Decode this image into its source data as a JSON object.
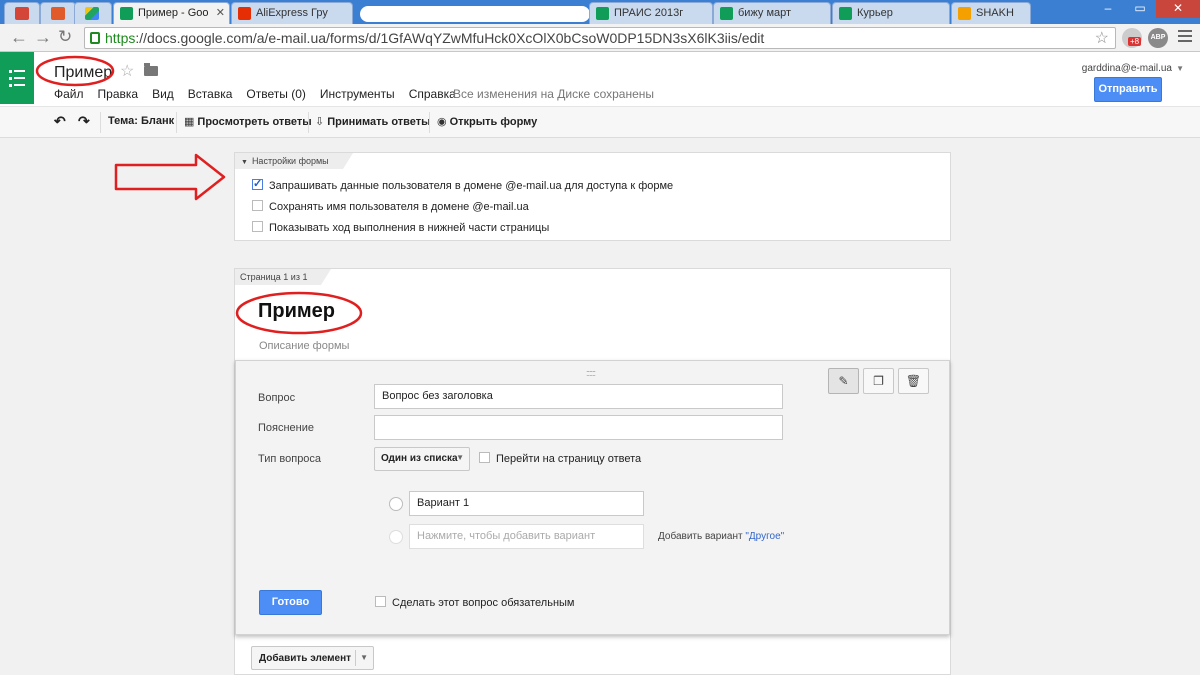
{
  "browser": {
    "tabs": [
      {
        "label": "",
        "icon": "gmail-icon"
      },
      {
        "label": "",
        "icon": "red-app-icon"
      },
      {
        "label": "",
        "icon": "drive-icon"
      },
      {
        "label": "Пример - Goo",
        "icon": "forms-icon",
        "active": true
      },
      {
        "label": "AliExpress Гру",
        "icon": "aliexpress-icon"
      },
      {
        "label": "ПРАИС 2013г",
        "icon": "sheets-icon"
      },
      {
        "label": "бижу март",
        "icon": "sheets-icon"
      },
      {
        "label": "Курьер",
        "icon": "sheets-icon"
      },
      {
        "label": "SHAKH",
        "icon": "shakh-icon"
      }
    ],
    "url_scheme": "https",
    "url_rest": "://docs.google.com/a/e-mail.ua/forms/d/1GfAWqYZwMfuHck0XcOlX0bCsoW0DP15DN3sX6lK3iis/edit",
    "ext_badge": "+8",
    "abp_label": "ABP"
  },
  "app": {
    "doc_title": "Пример",
    "menus": [
      "Файл",
      "Правка",
      "Вид",
      "Вставка",
      "Ответы (0)",
      "Инструменты",
      "Справка"
    ],
    "saved_status": "Все изменения на Диске сохранены",
    "user_email": "garddina@e-mail.ua",
    "send_label": "Отправить",
    "accent_color": "#4d8ef6",
    "brand_color": "#0f9d58"
  },
  "toolbar": {
    "theme_label": "Тема: Бланк",
    "view_responses_label": "Просмотреть ответы",
    "accept_responses_label": "Принимать ответы",
    "open_form_label": "Открыть форму"
  },
  "settings": {
    "header": "Настройки формы",
    "options": [
      {
        "label": "Запрашивать данные пользователя в домене @e-mail.ua для доступа к форме",
        "checked": true
      },
      {
        "label": "Сохранять имя пользователя в домене @e-mail.ua",
        "checked": false
      },
      {
        "label": "Показывать ход выполнения в нижней части страницы",
        "checked": false
      }
    ]
  },
  "form": {
    "page_label": "Страница 1 из 1",
    "title": "Пример",
    "description_placeholder": "Описание формы"
  },
  "question": {
    "question_label": "Вопрос",
    "question_value": "Вопрос без заголовка",
    "help_label": "Пояснение",
    "help_value": "",
    "type_label": "Тип вопроса",
    "type_value": "Один из списка",
    "go_to_page_label": "Перейти на страницу ответа",
    "option1": "Вариант 1",
    "add_option_placeholder": "Нажмите, чтобы добавить вариант",
    "add_other_prefix": "Добавить вариант",
    "add_other_link": "\"Другое\"",
    "done_label": "Готово",
    "required_label": "Сделать этот вопрос обязательным"
  },
  "add_element_label": "Добавить элемент"
}
